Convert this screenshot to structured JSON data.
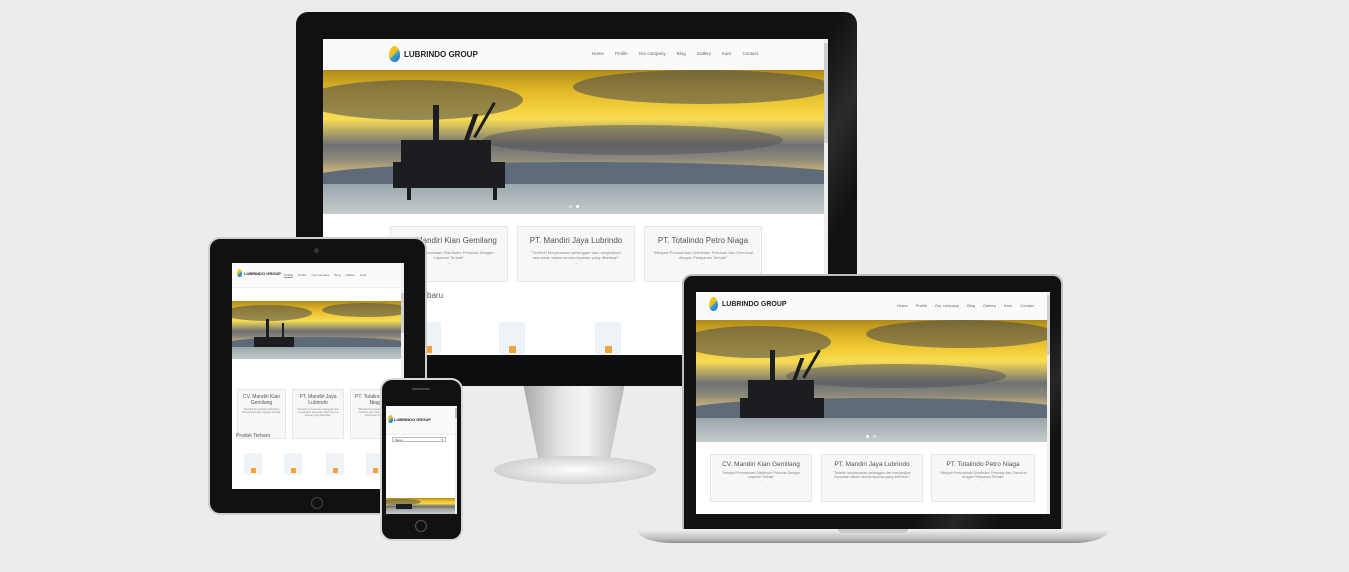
{
  "site": {
    "brand": "LUBRINDO GROUP",
    "nav": [
      "Home",
      "Profile",
      "Our company",
      "Blog",
      "Gallery",
      "Karir",
      "Contact"
    ],
    "tablet_nav": [
      "HOME",
      "Profile",
      "Our company",
      "Blog",
      "Gallery",
      "Karir"
    ],
    "cards": [
      {
        "title": "CV. Mandiri Kian Gemilang",
        "text": "\"Menjadi Perusahaan Distributor Pelumas Dengan Layanan Terbaik\"",
        "more": "..."
      },
      {
        "title": "PT. Mandiri Jaya Lubrindo",
        "text": "\"Terlebih kenyamanan pelanggan dan menjanjikan kepuasan dalam semua layanan yang diberikan\"",
        "more": "..."
      },
      {
        "title": "PT. Totalindo Petro Niaga",
        "text": "\"Menjadi Perusahaan Distributor Pelumas dan Chemical dengan Pelayanan Terbaik\"",
        "more": "..."
      }
    ],
    "section_title": "Produk Terbaru",
    "section_title_partial": "baru",
    "mobile_menu": "Menu"
  },
  "colors": {
    "background": "#ececec",
    "bezel": "#111111",
    "sky": "#f3cf3a",
    "accent_blue": "#1f6aa8"
  }
}
